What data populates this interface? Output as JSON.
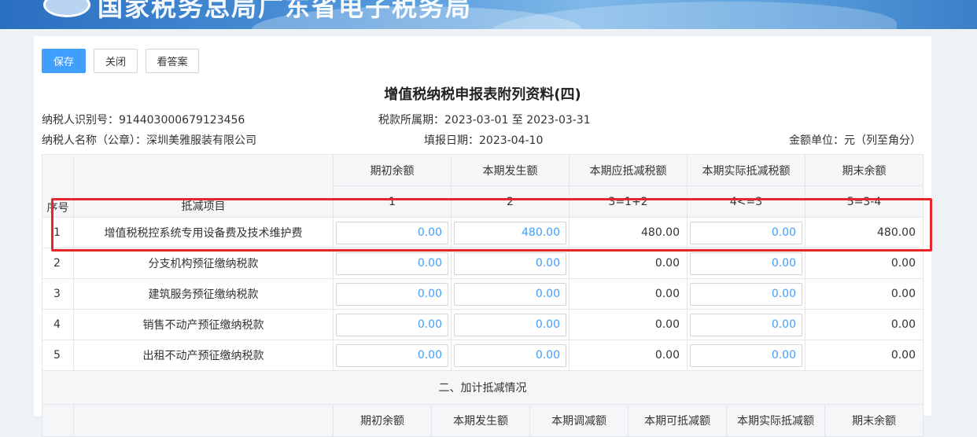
{
  "banner": {
    "title": "国家税务总局广东省电子税务局"
  },
  "toolbar": {
    "save_label": "保存",
    "close_label": "关闭",
    "answer_label": "看答案"
  },
  "form": {
    "title": "增值税纳税申报表附列资料(四)",
    "taxpayer_id": "纳税人识别号：914403000679123456",
    "tax_period": "税款所属期：2023-03-01 至 2023-03-31",
    "taxpayer_name": "纳税人名称（公章）：深圳美雅服装有限公司",
    "fill_date": "填报日期：2023-04-10",
    "unit": "金额单位：元（列至角分）"
  },
  "table": {
    "headers": {
      "seq": "序号",
      "item": "抵减项目",
      "cols": [
        "期初余额",
        "本期发生额",
        "本期应抵减税额",
        "本期实际抵减税额",
        "期末余额"
      ],
      "formulas": [
        "1",
        "2",
        "3=1+2",
        "4<=3",
        "5=3-4"
      ]
    },
    "rows": [
      {
        "seq": "1",
        "item": "增值税税控系统专用设备费及技术维护费",
        "opening": "0.00",
        "current": "480.00",
        "deductible": "480.00",
        "actual": "0.00",
        "closing": "480.00"
      },
      {
        "seq": "2",
        "item": "分支机构预征缴纳税款",
        "opening": "0.00",
        "current": "0.00",
        "deductible": "0.00",
        "actual": "0.00",
        "closing": "0.00"
      },
      {
        "seq": "3",
        "item": "建筑服务预征缴纳税款",
        "opening": "0.00",
        "current": "0.00",
        "deductible": "0.00",
        "actual": "0.00",
        "closing": "0.00"
      },
      {
        "seq": "4",
        "item": "销售不动产预征缴纳税款",
        "opening": "0.00",
        "current": "0.00",
        "deductible": "0.00",
        "actual": "0.00",
        "closing": "0.00"
      },
      {
        "seq": "5",
        "item": "出租不动产预征缴纳税款",
        "opening": "0.00",
        "current": "0.00",
        "deductible": "0.00",
        "actual": "0.00",
        "closing": "0.00"
      }
    ],
    "section2_title": "二、加计抵减情况",
    "section2_headers": [
      "期初余额",
      "本期发生额",
      "本期调减额",
      "本期可抵减额",
      "本期实际抵减额",
      "期末余额"
    ]
  },
  "colors": {
    "primary": "#409eff",
    "highlight": "#e8262a"
  }
}
